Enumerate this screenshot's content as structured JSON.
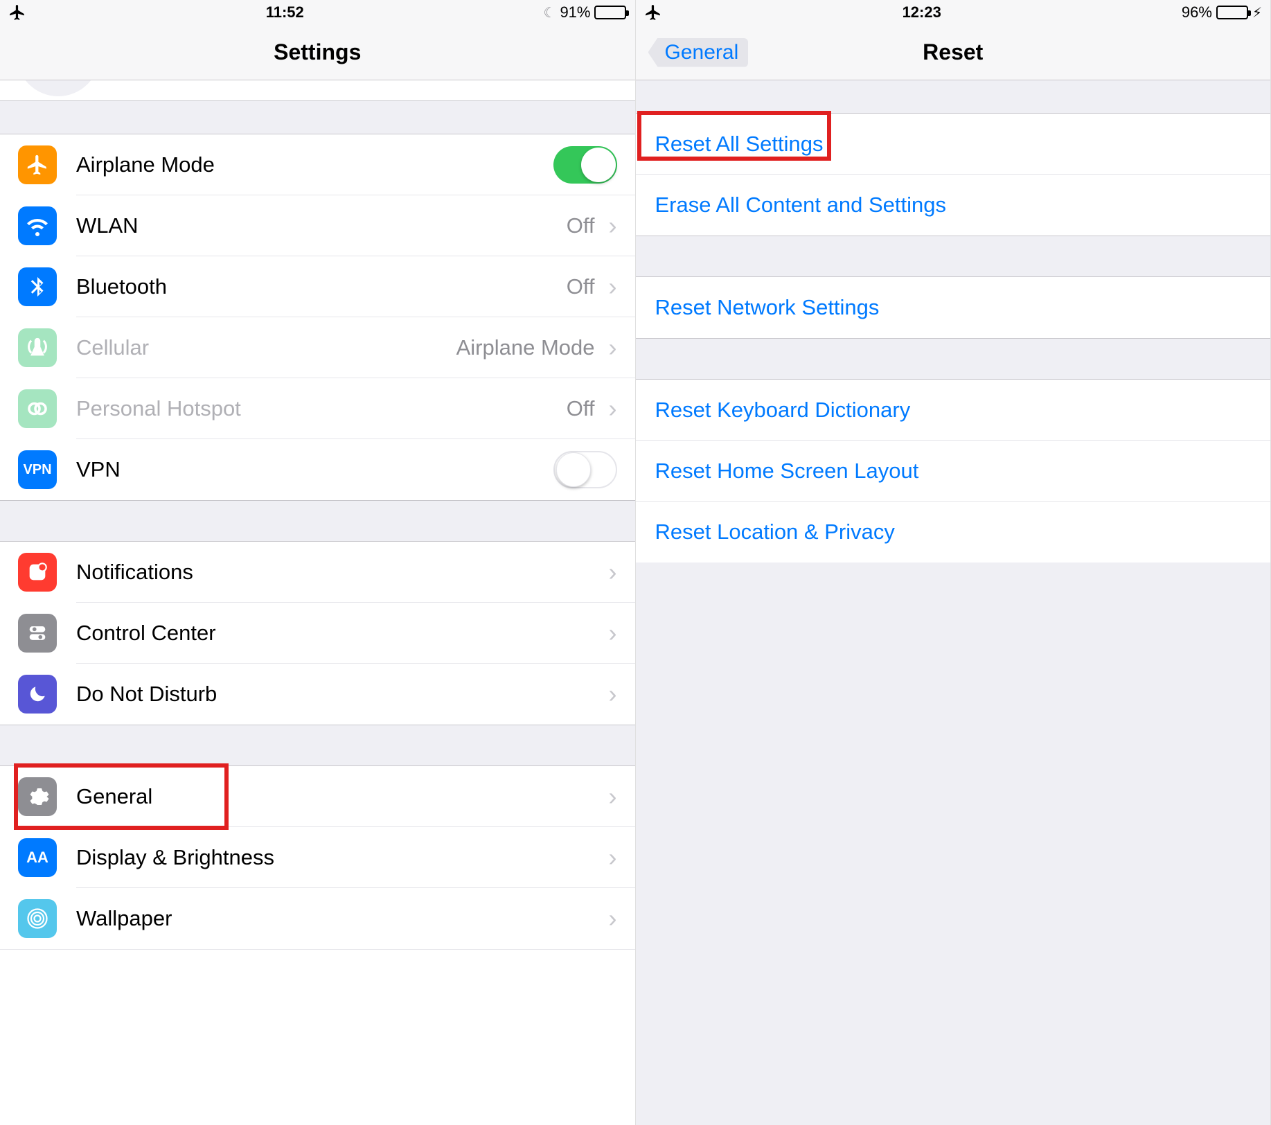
{
  "left": {
    "status": {
      "time": "11:52",
      "battery_pct": "91%"
    },
    "nav_title": "Settings",
    "group1": [
      {
        "key": "airplane",
        "label": "Airplane Mode",
        "value": "",
        "control": "toggle_on",
        "icon_bg": "#ff9500"
      },
      {
        "key": "wlan",
        "label": "WLAN",
        "value": "Off",
        "control": "disclosure",
        "icon_bg": "#007aff"
      },
      {
        "key": "bluetooth",
        "label": "Bluetooth",
        "value": "Off",
        "control": "disclosure",
        "icon_bg": "#007aff"
      },
      {
        "key": "cellular",
        "label": "Cellular",
        "value": "Airplane Mode",
        "control": "disclosure",
        "icon_bg": "#a5e5c0",
        "disabled": true
      },
      {
        "key": "hotspot",
        "label": "Personal Hotspot",
        "value": "Off",
        "control": "disclosure",
        "icon_bg": "#a5e5c0",
        "disabled": true
      },
      {
        "key": "vpn",
        "label": "VPN",
        "value": "",
        "control": "toggle_off",
        "icon_bg": "#007aff"
      }
    ],
    "group2": [
      {
        "key": "notifications",
        "label": "Notifications",
        "icon_bg": "#ff3b30"
      },
      {
        "key": "controlcenter",
        "label": "Control Center",
        "icon_bg": "#8e8e93"
      },
      {
        "key": "dnd",
        "label": "Do Not Disturb",
        "icon_bg": "#5856d6"
      }
    ],
    "group3": [
      {
        "key": "general",
        "label": "General",
        "icon_bg": "#8e8e93",
        "highlight": true
      },
      {
        "key": "display",
        "label": "Display & Brightness",
        "icon_bg": "#007aff"
      },
      {
        "key": "wallpaper",
        "label": "Wallpaper",
        "icon_bg": "#54c7ec"
      }
    ]
  },
  "right": {
    "status": {
      "time": "12:23",
      "battery_pct": "96%"
    },
    "back_label": "General",
    "nav_title": "Reset",
    "groupA": [
      {
        "key": "reset_all",
        "label": "Reset All Settings",
        "highlight": true
      },
      {
        "key": "erase_all",
        "label": "Erase All Content and Settings"
      }
    ],
    "groupB": [
      {
        "key": "reset_network",
        "label": "Reset Network Settings"
      }
    ],
    "groupC": [
      {
        "key": "reset_keyboard",
        "label": "Reset Keyboard Dictionary"
      },
      {
        "key": "reset_home",
        "label": "Reset Home Screen Layout"
      },
      {
        "key": "reset_location",
        "label": "Reset Location & Privacy"
      }
    ]
  }
}
